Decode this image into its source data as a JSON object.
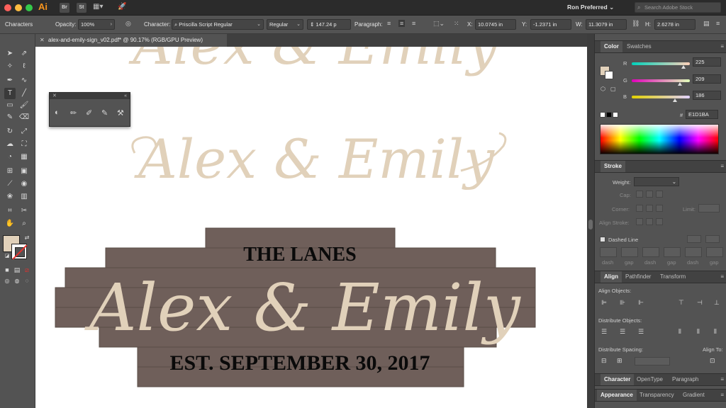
{
  "appbar": {
    "app_logo": "Ai",
    "app_icons": [
      "Br",
      "St"
    ],
    "profile": "Ron Preferred",
    "search_placeholder": "Search Adobe Stock"
  },
  "controlbar": {
    "panel_name": "Characters",
    "opacity_label": "Opacity:",
    "opacity_value": "100%",
    "character_label": "Character:",
    "font_family": "Priscilla Script Regular",
    "font_style": "Regular",
    "font_size": "147.24 p",
    "paragraph_label": "Paragraph:",
    "x_label": "X:",
    "x_value": "10.0745 in",
    "y_label": "Y:",
    "y_value": "-1.2371 in",
    "w_label": "W:",
    "w_value": "11.3079 in",
    "h_label": "H:",
    "h_value": "2.6278 in"
  },
  "document": {
    "tab_title": "alex-and-emily-sign_v02.pdf* @ 90.17% (RGB/GPU Preview)",
    "artwork": {
      "script_top": "Alex & Emily",
      "script_middle": "Alex & Emily",
      "sign_header": "THE LANES",
      "sign_script": "Alex & Emily",
      "sign_footer": "EST. SEPTEMBER 30, 2017"
    }
  },
  "colors": {
    "fill": "#E1D1BA",
    "sign_wood": "#6f5f5a",
    "script_tan": "#e1d1ba"
  },
  "color_panel": {
    "tabs": [
      "Color",
      "Swatches"
    ],
    "r_label": "R",
    "r_value": "225",
    "g_label": "G",
    "g_value": "209",
    "b_label": "B",
    "b_value": "186",
    "hex_label": "#",
    "hex_value": "E1D1BA"
  },
  "stroke_panel": {
    "title": "Stroke",
    "weight_label": "Weight:",
    "cap_label": "Cap:",
    "corner_label": "Corner:",
    "limit_label": "Limit:",
    "align_stroke_label": "Align Stroke:",
    "dashed_line_label": "Dashed Line",
    "dash_labels": [
      "dash",
      "gap",
      "dash",
      "gap",
      "dash",
      "gap"
    ]
  },
  "align_panel": {
    "tabs": [
      "Align",
      "Pathfinder",
      "Transform"
    ],
    "align_objects_label": "Align Objects:",
    "distribute_objects_label": "Distribute Objects:",
    "distribute_spacing_label": "Distribute Spacing:",
    "align_to_label": "Align To:"
  },
  "bottom_panels": {
    "row1_tabs": [
      "Character",
      "OpenType",
      "Paragraph"
    ],
    "row2_tabs": [
      "Appearance",
      "Transparency",
      "Gradient"
    ]
  },
  "tools": [
    "selection-tool",
    "direct-selection-tool",
    "magic-wand-tool",
    "lasso-tool",
    "pen-tool",
    "curvature-tool",
    "type-tool",
    "line-tool",
    "rectangle-tool",
    "paintbrush-tool",
    "shaper-tool",
    "eraser-tool",
    "rotate-tool",
    "scale-tool",
    "warp-tool",
    "free-transform-tool",
    "shape-builder-tool",
    "perspective-grid-tool",
    "mesh-tool",
    "gradient-tool",
    "eyedropper-tool",
    "blend-tool",
    "symbol-sprayer-tool",
    "column-graph-tool",
    "artboard-tool",
    "slice-tool",
    "hand-tool",
    "zoom-tool"
  ]
}
